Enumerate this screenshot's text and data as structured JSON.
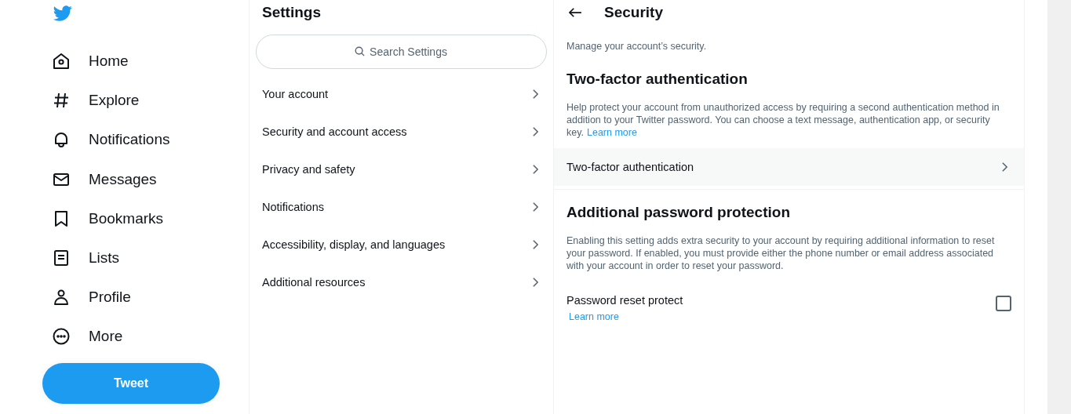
{
  "nav": {
    "items": [
      {
        "label": "Home"
      },
      {
        "label": "Explore"
      },
      {
        "label": "Notifications"
      },
      {
        "label": "Messages"
      },
      {
        "label": "Bookmarks"
      },
      {
        "label": "Lists"
      },
      {
        "label": "Profile"
      },
      {
        "label": "More"
      }
    ],
    "tweet_button": "Tweet"
  },
  "settings": {
    "title": "Settings",
    "search": {
      "placeholder": "Search Settings"
    },
    "items": [
      {
        "label": "Your account"
      },
      {
        "label": "Security and account access"
      },
      {
        "label": "Privacy and safety"
      },
      {
        "label": "Notifications"
      },
      {
        "label": "Accessibility, display, and languages"
      },
      {
        "label": "Additional resources"
      }
    ]
  },
  "security": {
    "title": "Security",
    "subtitle": "Manage your account’s security.",
    "sections": [
      {
        "kind": "link",
        "heading": "Two-factor authentication",
        "description": "Help protect your account from unauthorized access by requiring a second authentication method in addition to your Twitter password. You can choose a text message, authentication app, or security key.",
        "description_link": "Learn more",
        "row": {
          "label": "Two-factor authentication"
        }
      },
      {
        "kind": "checkbox",
        "heading": "Additional password protection",
        "description": "Enabling this setting adds extra security to your account by requiring additional information to reset your password. If enabled, you must provide either the phone number or email address associated with your account in order to reset your password.",
        "row": {
          "label": "Password reset protect",
          "link": "Learn more",
          "checked": false
        }
      }
    ]
  }
}
